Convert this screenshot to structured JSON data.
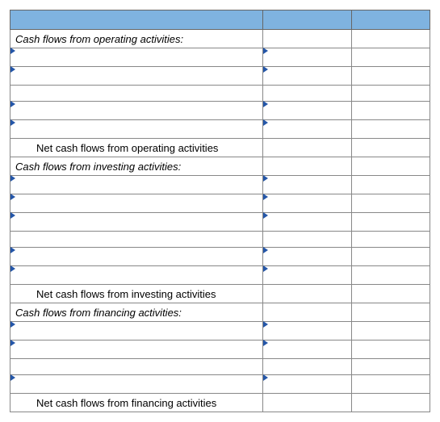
{
  "header": "",
  "sections": {
    "operating": {
      "title": "Cash flows from operating activities:",
      "subtotal": "Net cash flows from operating activities",
      "rows": [
        {
          "desc": "",
          "val": ""
        },
        {
          "desc": "",
          "val": ""
        },
        {
          "desc": "",
          "val": ""
        },
        {
          "desc": "",
          "val": ""
        }
      ],
      "subtotal_val": ""
    },
    "investing": {
      "title": "Cash flows from investing activities:",
      "subtotal": "Net cash flows from investing activities",
      "rows": [
        {
          "desc": "",
          "val": ""
        },
        {
          "desc": "",
          "val": ""
        },
        {
          "desc": "",
          "val": ""
        },
        {
          "desc": "",
          "val": ""
        },
        {
          "desc": "",
          "val": ""
        }
      ],
      "subtotal_val": ""
    },
    "financing": {
      "title": "Cash flows from financing activities:",
      "subtotal": "Net cash flows from financing activities",
      "rows": [
        {
          "desc": "",
          "val": ""
        },
        {
          "desc": "",
          "val": ""
        },
        {
          "desc": "",
          "val": ""
        }
      ],
      "subtotal_val": ""
    }
  }
}
